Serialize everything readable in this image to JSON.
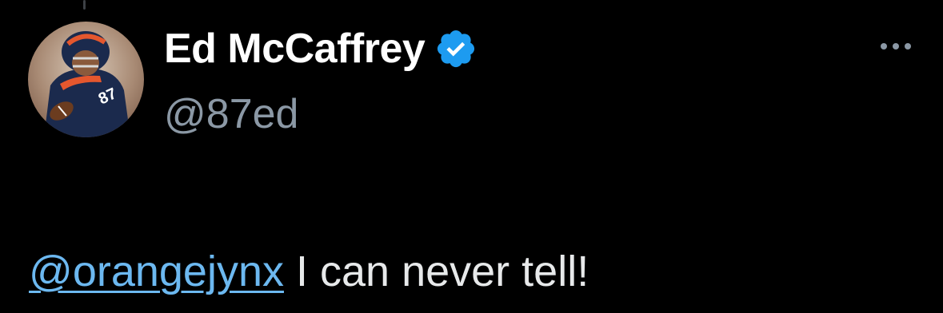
{
  "author": {
    "display_name": "Ed McCaffrey",
    "handle": "@87ed",
    "verified": true,
    "avatar_icon": "football-player-avatar",
    "jersey_number": "87"
  },
  "actions": {
    "more_icon": "more-options-icon"
  },
  "tweet": {
    "mention": "@orangejynx",
    "text": " I can never tell!"
  },
  "colors": {
    "background": "#000000",
    "name": "#ffffff",
    "handle": "#8b98a5",
    "mention": "#6cb8f0",
    "verified": "#1d9bf0",
    "body_text": "#e7e9ea"
  }
}
